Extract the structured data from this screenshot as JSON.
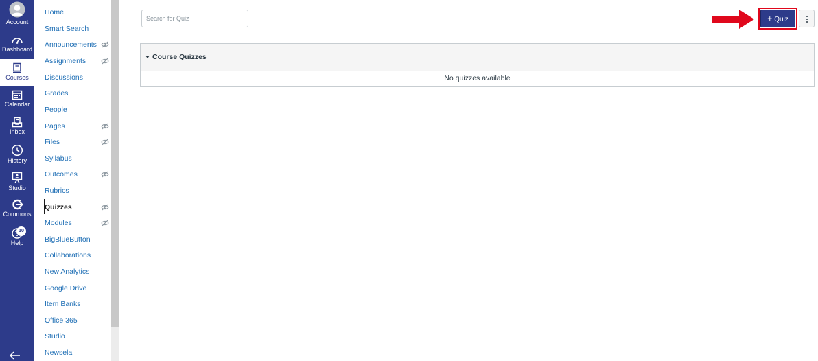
{
  "global_nav": {
    "items": [
      {
        "label": "Account",
        "icon": "account-icon",
        "active": false
      },
      {
        "label": "Dashboard",
        "icon": "dashboard-icon",
        "active": false
      },
      {
        "label": "Courses",
        "icon": "courses-icon",
        "active": true
      },
      {
        "label": "Calendar",
        "icon": "calendar-icon",
        "active": false
      },
      {
        "label": "Inbox",
        "icon": "inbox-icon",
        "active": false
      },
      {
        "label": "History",
        "icon": "history-icon",
        "active": false
      },
      {
        "label": "Studio",
        "icon": "studio-icon",
        "active": false
      },
      {
        "label": "Commons",
        "icon": "commons-icon",
        "active": false
      },
      {
        "label": "Help",
        "icon": "help-icon",
        "active": false
      }
    ],
    "help_badge": "10",
    "collapse_icon": "collapse-nav-icon",
    "colors": {
      "background": "#2d3b8a",
      "active_background": "#ffffff"
    }
  },
  "course_nav": {
    "items": [
      {
        "label": "Home",
        "hidden_eye": false
      },
      {
        "label": "Smart Search",
        "hidden_eye": false
      },
      {
        "label": "Announcements",
        "hidden_eye": true
      },
      {
        "label": "Assignments",
        "hidden_eye": true
      },
      {
        "label": "Discussions",
        "hidden_eye": false
      },
      {
        "label": "Grades",
        "hidden_eye": false
      },
      {
        "label": "People",
        "hidden_eye": false
      },
      {
        "label": "Pages",
        "hidden_eye": true
      },
      {
        "label": "Files",
        "hidden_eye": true
      },
      {
        "label": "Syllabus",
        "hidden_eye": false
      },
      {
        "label": "Outcomes",
        "hidden_eye": true
      },
      {
        "label": "Rubrics",
        "hidden_eye": false
      },
      {
        "label": "Quizzes",
        "hidden_eye": true,
        "active": true
      },
      {
        "label": "Modules",
        "hidden_eye": true
      },
      {
        "label": "BigBlueButton",
        "hidden_eye": false
      },
      {
        "label": "Collaborations",
        "hidden_eye": false
      },
      {
        "label": "New Analytics",
        "hidden_eye": false
      },
      {
        "label": "Google Drive",
        "hidden_eye": false
      },
      {
        "label": "Item Banks",
        "hidden_eye": false
      },
      {
        "label": "Office 365",
        "hidden_eye": false
      },
      {
        "label": "Studio",
        "hidden_eye": false
      },
      {
        "label": "Newsela",
        "hidden_eye": false
      }
    ],
    "colors": {
      "link": "#1f6fb5",
      "active": "#1b1b1b"
    }
  },
  "toolbar": {
    "search_placeholder": "Search for Quiz",
    "add_quiz_label": "Quiz",
    "add_quiz_icon": "plus-icon",
    "more_icon": "kebab-menu-icon",
    "colors": {
      "button": "#2d3b8a",
      "highlight": "#e0081c"
    }
  },
  "quizzes_panel": {
    "title": "Course Quizzes",
    "empty_message": "No quizzes available"
  }
}
